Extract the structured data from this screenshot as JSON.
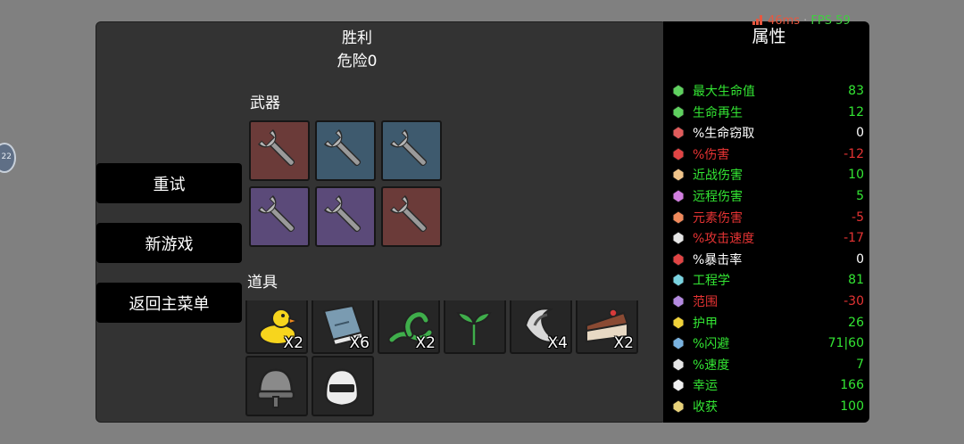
{
  "header": {
    "title": "胜利",
    "subtitle": "危险0"
  },
  "sidebar": {
    "buttons": [
      "重试",
      "新游戏",
      "返回主菜单"
    ]
  },
  "weapons": {
    "label": "武器",
    "slots": [
      {
        "icon": "wrench-icon",
        "tier": "red"
      },
      {
        "icon": "wrench-icon",
        "tier": "blue"
      },
      {
        "icon": "wrench-icon",
        "tier": "blue"
      },
      {
        "icon": "wrench-icon",
        "tier": "purple"
      },
      {
        "icon": "wrench-icon",
        "tier": "purple"
      },
      {
        "icon": "wrench-icon",
        "tier": "red"
      }
    ]
  },
  "items": {
    "label": "道具",
    "slots": [
      {
        "icon": "rubber-duck-icon",
        "count": "X2"
      },
      {
        "icon": "book-icon",
        "count": "X6"
      },
      {
        "icon": "snake-icon",
        "count": "X2"
      },
      {
        "icon": "sprout-icon",
        "count": ""
      },
      {
        "icon": "cape-icon",
        "count": "X4"
      },
      {
        "icon": "cake-slice-icon",
        "count": "X2"
      },
      {
        "icon": "helmet-icon",
        "count": ""
      },
      {
        "icon": "visor-helmet-icon",
        "count": ""
      }
    ]
  },
  "stats": {
    "title": "属性",
    "rows": [
      {
        "icon": "heart-icon",
        "name": "最大生命值",
        "value": "83",
        "color": "green"
      },
      {
        "icon": "regen-icon",
        "name": "生命再生",
        "value": "12",
        "color": "green"
      },
      {
        "icon": "lifesteal-icon",
        "name": "%生命窃取",
        "value": "0",
        "color": "white"
      },
      {
        "icon": "damage-icon",
        "name": "%伤害",
        "value": "-12",
        "color": "red"
      },
      {
        "icon": "sword-icon",
        "name": "近战伤害",
        "value": "10",
        "color": "green"
      },
      {
        "icon": "bow-icon",
        "name": "远程伤害",
        "value": "5",
        "color": "green"
      },
      {
        "icon": "flame-icon",
        "name": "元素伤害",
        "value": "-5",
        "color": "red"
      },
      {
        "icon": "hourglass-icon",
        "name": "%攻击速度",
        "value": "-17",
        "color": "red"
      },
      {
        "icon": "crit-icon",
        "name": "%暴击率",
        "value": "0",
        "color": "white"
      },
      {
        "icon": "engineering-icon",
        "name": "工程学",
        "value": "81",
        "color": "green"
      },
      {
        "icon": "range-icon",
        "name": "范围",
        "value": "-30",
        "color": "red"
      },
      {
        "icon": "shield-icon",
        "name": "护甲",
        "value": "26",
        "color": "green"
      },
      {
        "icon": "dodge-icon",
        "name": "%闪避",
        "value": "71|60",
        "color": "green"
      },
      {
        "icon": "speed-icon",
        "name": "%速度",
        "value": "7",
        "color": "green"
      },
      {
        "icon": "luck-icon",
        "name": "幸运",
        "value": "166",
        "color": "green"
      },
      {
        "icon": "harvest-icon",
        "name": "收获",
        "value": "100",
        "color": "green"
      }
    ]
  },
  "overlay": {
    "latency": "46ms",
    "separator": "·",
    "fps": "FPS 59",
    "edge_badge": "22"
  },
  "colors": {
    "green": "#33e533",
    "red": "#e53333",
    "white": "#ffffff"
  }
}
